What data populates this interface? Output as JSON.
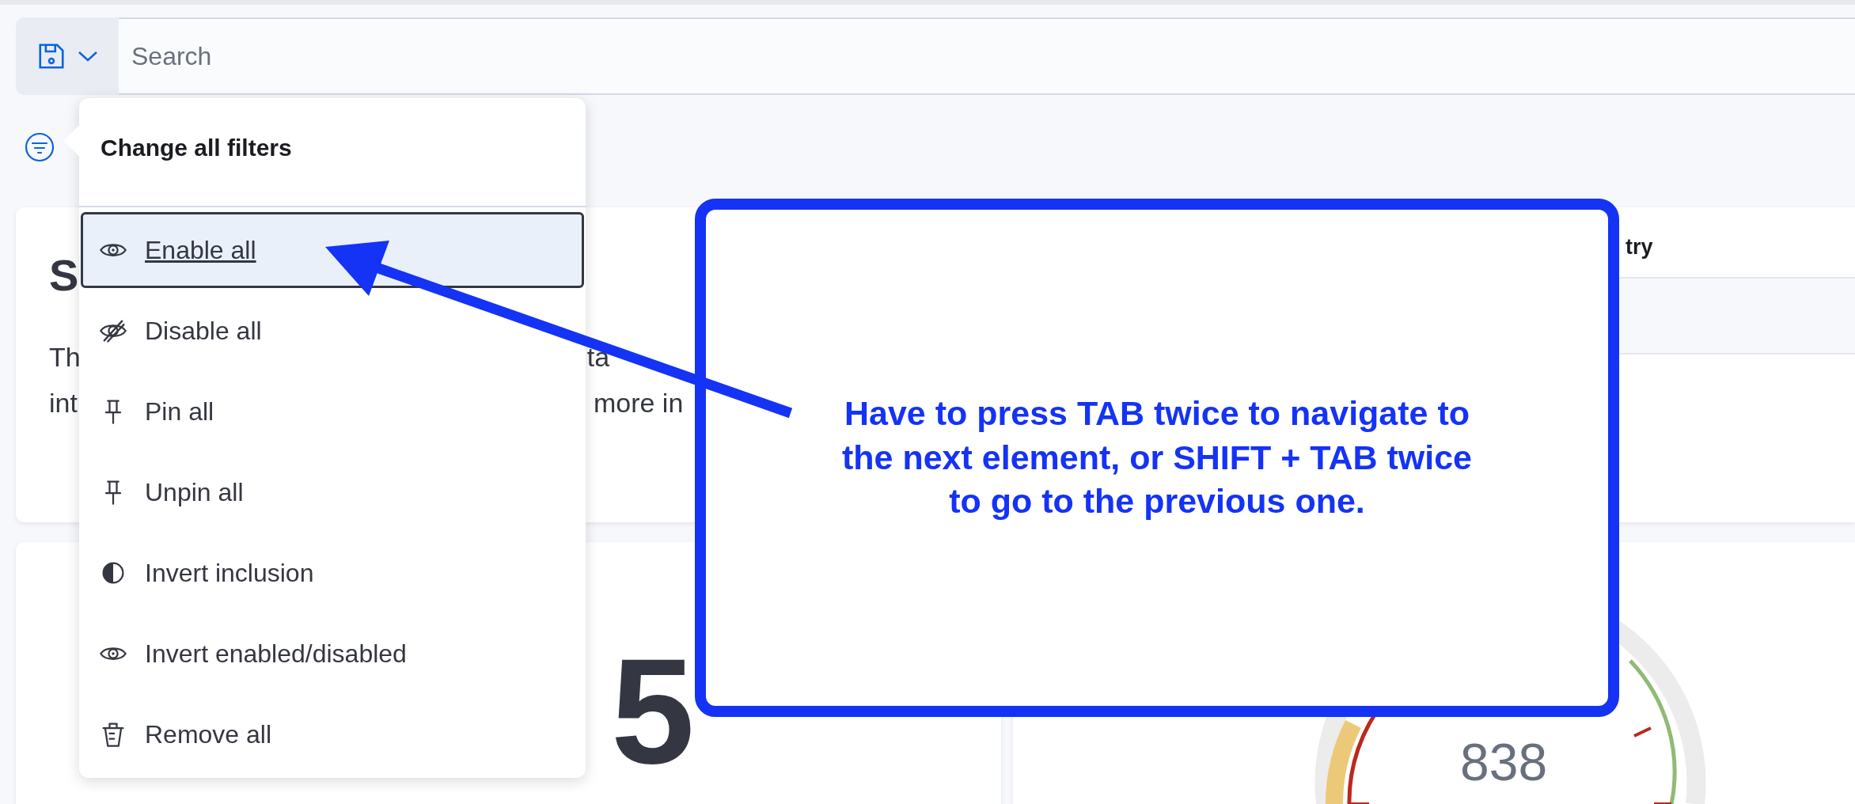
{
  "search": {
    "placeholder": "Search"
  },
  "filter_menu": {
    "title": "Change all filters",
    "items": [
      {
        "label": "Enable all",
        "selected": true
      },
      {
        "label": "Disable all",
        "selected": false
      },
      {
        "label": "Pin all",
        "selected": false
      },
      {
        "label": "Unpin all",
        "selected": false
      },
      {
        "label": "Invert inclusion",
        "selected": false
      },
      {
        "label": "Invert enabled/disabled",
        "selected": false
      },
      {
        "label": "Remove all",
        "selected": false
      }
    ]
  },
  "text_card": {
    "heading": "S",
    "line_1_start": "Th",
    "line_1_end": "ta",
    "line_2_start": "int",
    "line_2_end": "more in"
  },
  "table_card": {
    "column_1": "try"
  },
  "metric_card": {
    "value": "5"
  },
  "gauge_card": {
    "value": "838"
  },
  "annotation": {
    "text": "Have to press TAB twice to navigate to the next element, or SHIFT + TAB twice to go to the previous one."
  }
}
